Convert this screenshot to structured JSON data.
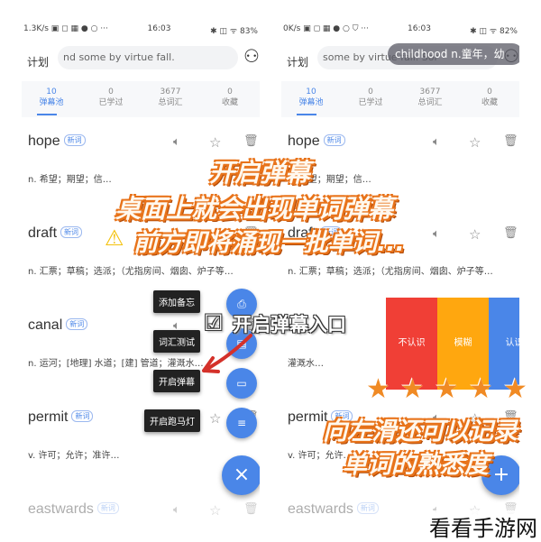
{
  "colors": {
    "accent": "#4a86e8",
    "unknown": "#f03f36",
    "fuzzy": "#ffa70f",
    "known": "#4a86e8",
    "overlay_outline": "#e8731a"
  },
  "left": {
    "status": {
      "left": "1.3K/s ▣ ◻ ▦ ● ○ ···",
      "time": "16:03",
      "right": "✱ ◫ ᯤ 83%"
    },
    "plan": "计划",
    "search": "nd some by virtue fall.",
    "stats": [
      {
        "value": "10",
        "label": "弹幕池"
      },
      {
        "value": "0",
        "label": "已学过"
      },
      {
        "value": "3677",
        "label": "总词汇"
      },
      {
        "value": "0",
        "label": "收藏"
      }
    ],
    "words": [
      {
        "word": "hope",
        "tag": "新词",
        "def": "n. 希望；期望；信…"
      },
      {
        "word": "draft",
        "tag": "新词",
        "def": "n. 汇票；草稿；选派；（尤指房间、烟囱、炉子等…"
      },
      {
        "word": "canal",
        "tag": "新词",
        "def": "n. 运河；[地理] 水道；[建] 管道；灌溉水…"
      },
      {
        "word": "permit",
        "tag": "新词",
        "def": "v. 许可；允许；准许…"
      },
      {
        "word": "eastwards",
        "tag": "新词",
        "def": ""
      }
    ],
    "menu": [
      "添加备忘",
      "词汇测试",
      "开启弹幕",
      "开启跑马灯"
    ],
    "fab": "×"
  },
  "right": {
    "status": {
      "left": "0K/s ▣ ◻ ▦ ● ○ ⛉ ···",
      "time": "16:03",
      "right": "✱ ◫ ᯤ 82%"
    },
    "plan": "计划",
    "search": "some by virtue fall.        Sor",
    "banner": "childhood  n.童年，幼",
    "stats": [
      {
        "value": "10",
        "label": "弹幕池"
      },
      {
        "value": "0",
        "label": "已学过"
      },
      {
        "value": "3677",
        "label": "总词汇"
      },
      {
        "value": "0",
        "label": "收藏"
      }
    ],
    "words": [
      {
        "word": "hope",
        "tag": "新词",
        "def": "n. 希望；期望；信…"
      },
      {
        "word": "draft",
        "tag": "新词",
        "def": "n. 汇票；草稿；选派；（尤指房间、烟囱、炉子等…"
      },
      {
        "word": "",
        "tag": "",
        "def": "灌溉水…"
      },
      {
        "word": "permit",
        "tag": "新词",
        "def": "v. 许可；允许…"
      },
      {
        "word": "eastwards",
        "tag": "新词",
        "def": ""
      }
    ],
    "swipe": [
      "不认识",
      "模糊",
      "认识"
    ],
    "fab": "+"
  },
  "overlay": {
    "line1": "开启弹幕",
    "line2": "桌面上就会出现单词弹幕",
    "line3": "前方即将涌现一批单词...",
    "entry": "开启弹幕入口",
    "swipe1": "向左滑还可以记录",
    "swipe2": "单词的熟悉度",
    "stars": 5,
    "watermark": "看看手游网"
  }
}
